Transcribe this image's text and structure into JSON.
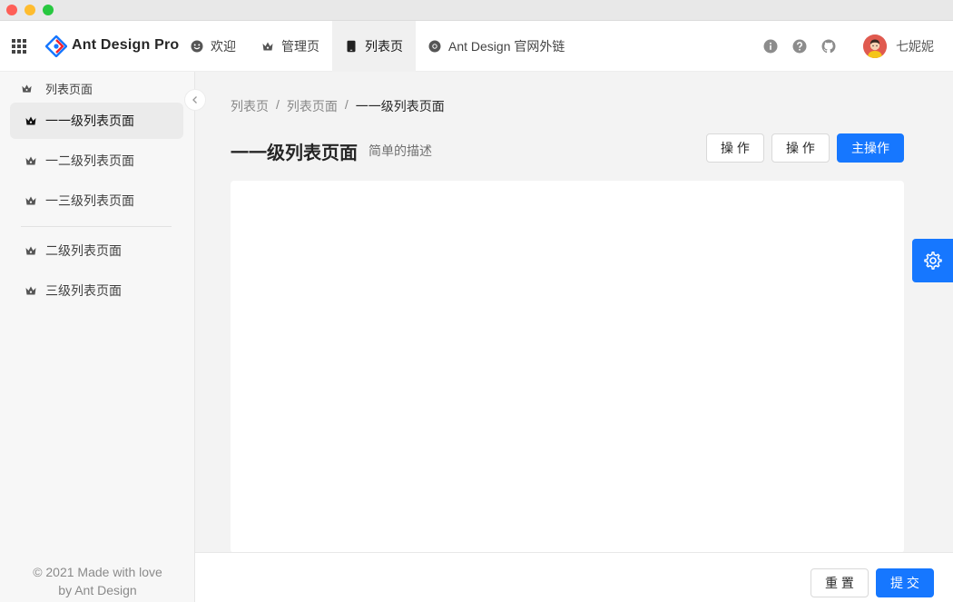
{
  "brand": {
    "name": "Ant Design Pro"
  },
  "top_menu": [
    {
      "label": "欢迎",
      "icon": "smile-icon"
    },
    {
      "label": "管理页",
      "icon": "crown-icon"
    },
    {
      "label": "列表页",
      "icon": "tablet-icon"
    },
    {
      "label": "Ant Design 官网外链",
      "icon": "chrome-icon"
    }
  ],
  "user": {
    "name": "七妮妮"
  },
  "sidebar": {
    "group_label": "列表页面",
    "items": [
      {
        "label": "一一级列表页面"
      },
      {
        "label": "一二级列表页面"
      },
      {
        "label": "一三级列表页面"
      },
      {
        "label": "二级列表页面"
      },
      {
        "label": "三级列表页面"
      }
    ],
    "footer_line1": "© 2021 Made with love",
    "footer_line2": "by Ant Design"
  },
  "breadcrumb": [
    {
      "label": "列表页"
    },
    {
      "label": "/"
    },
    {
      "label": "列表页面"
    },
    {
      "label": "/"
    },
    {
      "label": "一一级列表页面"
    }
  ],
  "page": {
    "title": "一一级列表页面",
    "subtitle": "简单的描述",
    "action1": "操 作",
    "action2": "操 作",
    "primary_action": "主操作"
  },
  "footer_bar": {
    "reset": "重 置",
    "submit": "提 交"
  },
  "colors": {
    "primary": "#1677ff"
  }
}
